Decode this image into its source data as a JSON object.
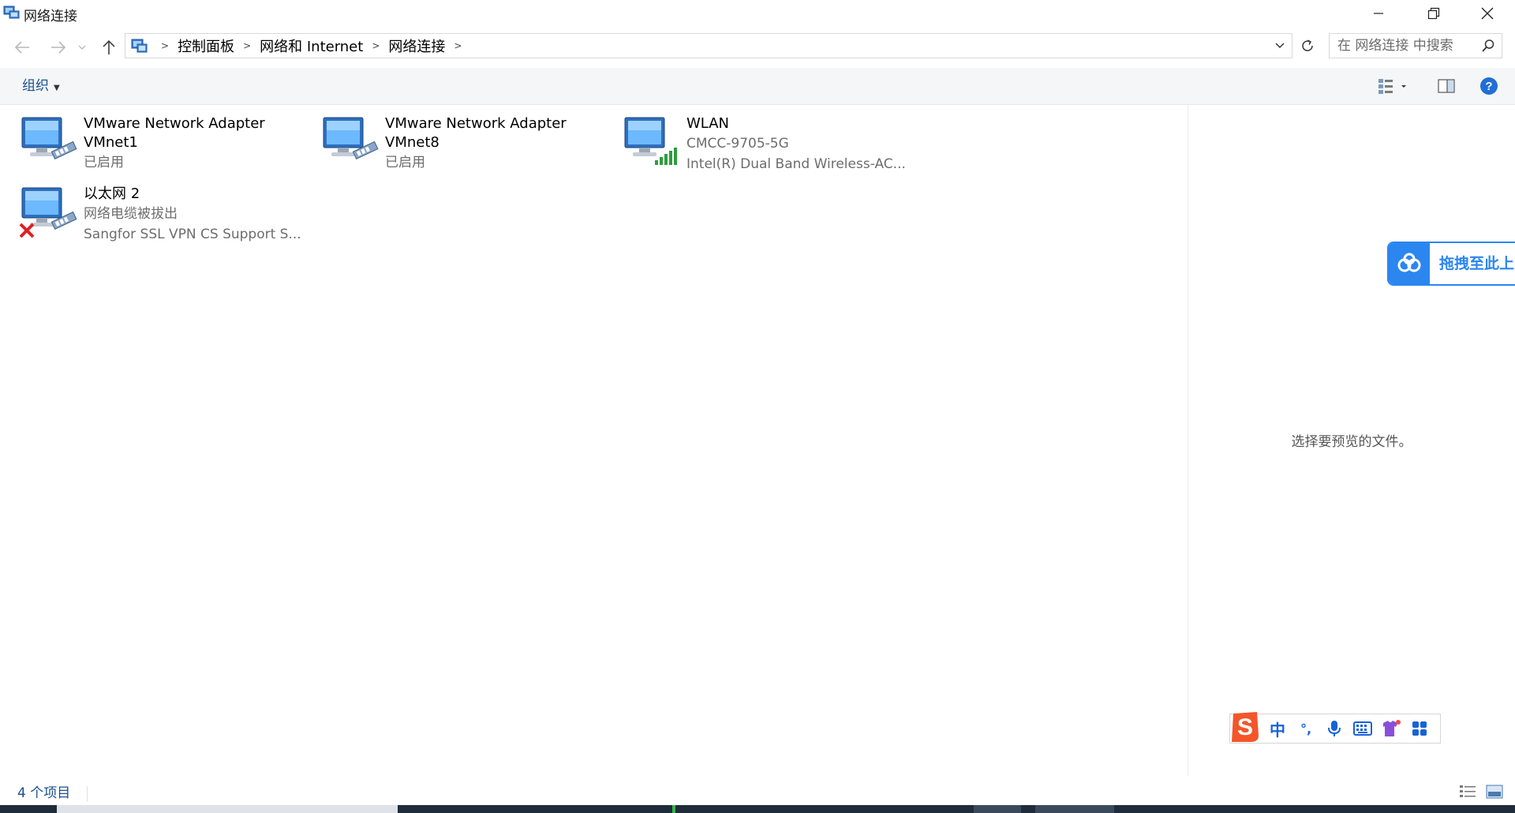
{
  "window": {
    "title": "网络连接"
  },
  "address": {
    "crumbs": [
      "控制面板",
      "网络和 Internet",
      "网络连接"
    ],
    "search_placeholder": "在 网络连接 中搜索"
  },
  "toolbar": {
    "organize_label": "组织"
  },
  "items": [
    {
      "name": "VMware Network Adapter VMnet1",
      "line1": "",
      "line2": "已启用",
      "icon": "wired-network-icon"
    },
    {
      "name": "VMware Network Adapter VMnet8",
      "line1": "",
      "line2": "已启用",
      "icon": "wired-network-icon"
    },
    {
      "name": "WLAN",
      "line1": "CMCC-9705-5G",
      "line2": "Intel(R) Dual Band Wireless-AC...",
      "icon": "wifi-network-icon"
    },
    {
      "name": "以太网 2",
      "line1": "网络电缆被拔出",
      "line2": "Sangfor SSL VPN CS Support S...",
      "icon": "disconnected-network-icon"
    }
  ],
  "preview": {
    "message": "选择要预览的文件。"
  },
  "baidu": {
    "label": "拖拽至此上"
  },
  "ime": {
    "mode_label": "中",
    "punct_label": "°,"
  },
  "status": {
    "count_label": "4 个项目"
  },
  "colors": {
    "link_blue": "#1a4f8f",
    "baidu_blue": "#2b86f0",
    "sogou_orange": "#f4562a"
  }
}
